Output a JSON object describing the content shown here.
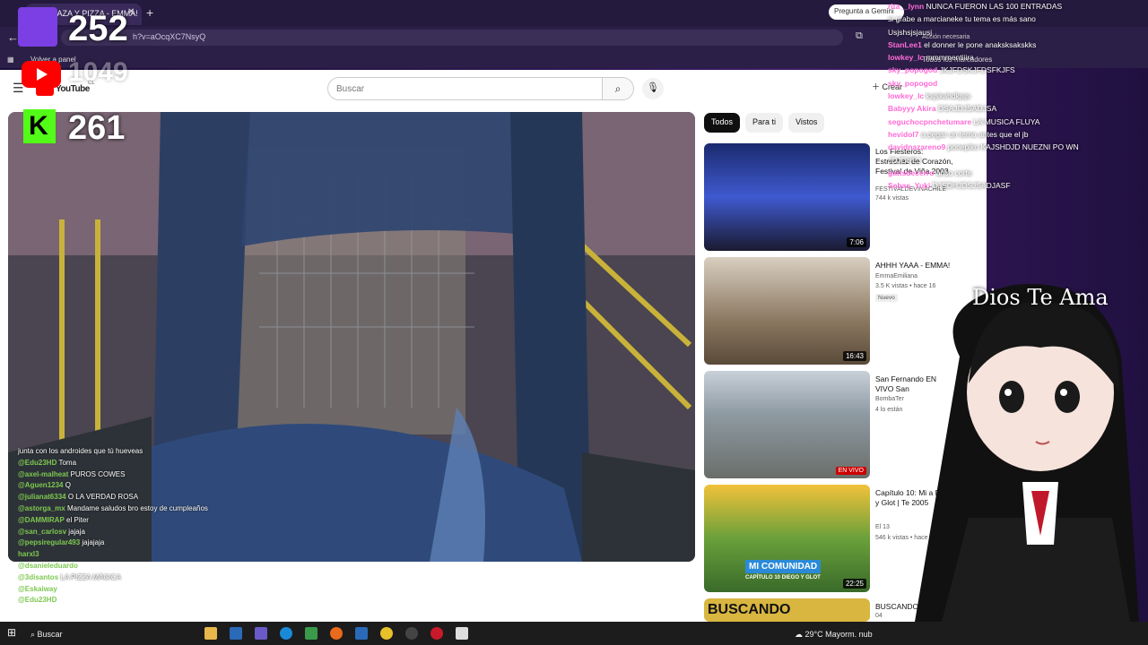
{
  "browser": {
    "tab_title": "(50) P·AZA Y PIZZA - EMMA!",
    "address": "h?v=aOcqXC7NsyQ",
    "bookmark_panel": "Volver a panel",
    "bookmark_all": "Todos los marcadores",
    "gemini_button": "Pregunta a Gemini",
    "action_required": "Acción necesaria"
  },
  "youtube": {
    "logo_text": "YouTube",
    "country_code": "CL",
    "search_placeholder": "Buscar",
    "create_label": "Crear",
    "chips": [
      "Todos",
      "Para ti",
      "Vistos"
    ],
    "recommendations": [
      {
        "title": "Los Fiesteros: Estrechez de Corazón, Festival de Viña 2003",
        "channel": "FESTIVALDEVINACHILE",
        "meta": "744 k vistas",
        "duration": "7:06",
        "thumb_color": "#2a3f8a"
      },
      {
        "title": "AHHH YAAA - EMMA!",
        "channel": "EmmaEmiliana",
        "meta": "3.5 K vistas • hace 16",
        "duration": "16:43",
        "badge": "Nuevo",
        "thumb_color": "#7a6a5a"
      },
      {
        "title": "San Fernando EN VIVO San",
        "channel": "BombaTer",
        "meta": "4 lo están",
        "live_badge": "EN VIVO",
        "thumb_color": "#6f7d88"
      },
      {
        "title": "Capítulo 10: Mi a Diego y Glot | Te 2005",
        "channel": "El 13",
        "meta": "546 k vistas • hace",
        "duration": "22:25",
        "thumb_text": "MI COMUNIDAD",
        "thumb_sub": "CAPÍTULO 10 DIEGO Y GLOT",
        "thumb_color": "#4b7a2e"
      },
      {
        "title": "BUSCANDO",
        "channel": "04",
        "meta": "",
        "thumb_text": "BUSCANDO",
        "thumb_color": "#d8b640"
      }
    ]
  },
  "overlays": {
    "twitch_count": "252",
    "youtube_count": "1049",
    "kick_count": "261",
    "watermark": "Dios Te Ama"
  },
  "chat_left": [
    {
      "user": "",
      "msg": "junta con los androides que tú hueveas"
    },
    {
      "user": "@Edu23HD",
      "msg": "Toma"
    },
    {
      "user": "@axel-malheat",
      "msg": "PUROS COWES"
    },
    {
      "user": "@Aguen1234",
      "msg": "Q"
    },
    {
      "user": "@julianat6334",
      "msg": "O LA VERDAD ROSA"
    },
    {
      "user": "@astorga_mx",
      "msg": "Mandame saludos bro estoy de cumpleaños"
    },
    {
      "user": "@DAMMIRAP",
      "msg": "el Piter"
    },
    {
      "user": "@san_carlosv",
      "msg": "jajaja"
    },
    {
      "user": "@pepsiregular493",
      "msg": "jajajaja"
    },
    {
      "user": "harxl3",
      "msg": ""
    },
    {
      "user": "@dsanieleduardo",
      "msg": ""
    },
    {
      "user": "@3disantos",
      "msg": "LA PIZZA MÁGICA"
    },
    {
      "user": "@Eskaiway",
      "msg": ""
    },
    {
      "user": "@Edu23HD",
      "msg": ""
    }
  ],
  "chat_right": [
    {
      "user": "rita__lynn",
      "msg": "NUNCA FUERON LAS 100 ENTRADAS"
    },
    {
      "user": "",
      "msg": "si grabe a marcianeke tu tema es más sano"
    },
    {
      "user": "",
      "msg": "Usjshsjsjausj"
    },
    {
      "user": "StanLee1",
      "msg": "el donner le pone anaksksakskks"
    },
    {
      "user": "lowkey_lc",
      "msg": "mmmmentiiira"
    },
    {
      "user": "sky_popogod",
      "msg": "JKJFDSKJFDSFKJFS"
    },
    {
      "user": "sky_popogod",
      "msg": ""
    },
    {
      "user": "lowkey_lc",
      "msg": "ksjskahdkjsjs"
    },
    {
      "user": "Babyyy Akira",
      "msg": "DSAJDJSADJSA"
    },
    {
      "user": "seguchocpnchetumare",
      "msg": "LA MUSICA FLUYA"
    },
    {
      "user": "hevidol7",
      "msg": "a pegar un tema antes que el jb"
    },
    {
      "user": "davidnazareno9",
      "msg": "ponepiko KAJSHDJD NUEZNI PO WN"
    },
    {
      "user": "",
      "msg": "JDJDHEJ"
    },
    {
      "user": "gattsdecerro",
      "msg": "anso corte"
    },
    {
      "user": "Sebas_Yuki",
      "msg": "DJSDHJDSJSADJASF"
    }
  ],
  "taskbar": {
    "search": "Buscar",
    "weather": "29°C  Mayorm. nub"
  },
  "colors": {
    "youtube_red": "#ff0000",
    "twitch_purple": "#7b3fe4",
    "kick_green": "#53fc18"
  }
}
